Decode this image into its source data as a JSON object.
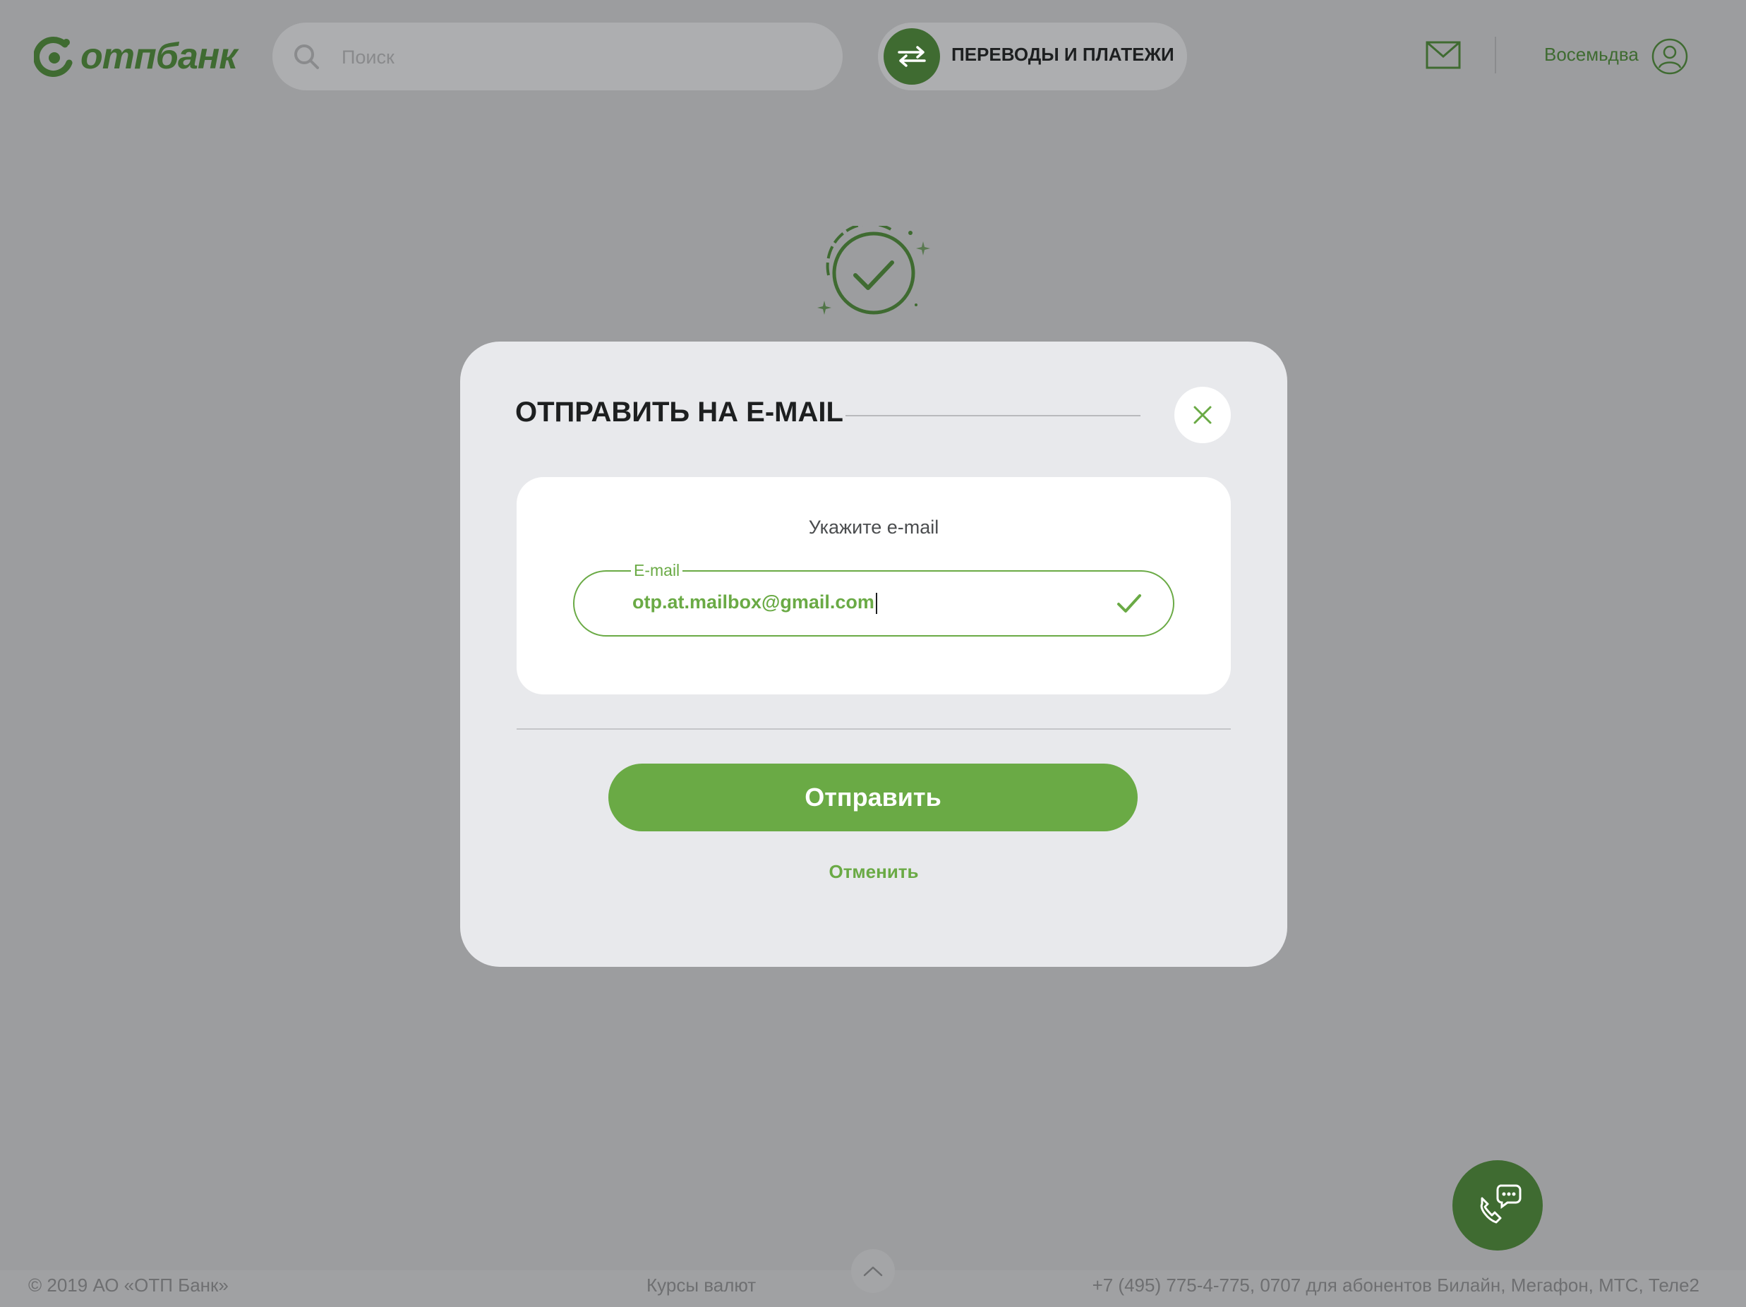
{
  "header": {
    "logo_text": "отпбанк",
    "search_placeholder": "Поиск",
    "transfers_label": "ПЕРЕВОДЫ И ПЛАТЕЖИ",
    "username": "Восемьдва"
  },
  "modal": {
    "title": "ОТПРАВИТЬ НА E-MAIL",
    "card_label": "Укажите e-mail",
    "email_field_label": "E-mail",
    "email_value": "otp.at.mailbox@gmail.com",
    "send_label": "Отправить",
    "cancel_label": "Отменить"
  },
  "footer": {
    "copyright": "© 2019 АО «ОТП Банк»",
    "rates_link": "Курсы валют",
    "phones": "+7 (495) 775-4-775,  0707 для абонентов Билайн, Мегафон, МТС, Теле2"
  },
  "colors": {
    "brand_dark_green": "#3f6b31",
    "accent_green": "#6aaa45",
    "overlay_gray": "#9c9d9f",
    "modal_bg": "#e8e9ec"
  },
  "icons": [
    "otp-logo-icon",
    "search-icon",
    "transfer-arrows-icon",
    "mail-icon",
    "user-avatar-icon",
    "success-check-icon",
    "close-icon",
    "input-valid-check-icon",
    "phone-chat-icon",
    "chevron-up-icon"
  ]
}
